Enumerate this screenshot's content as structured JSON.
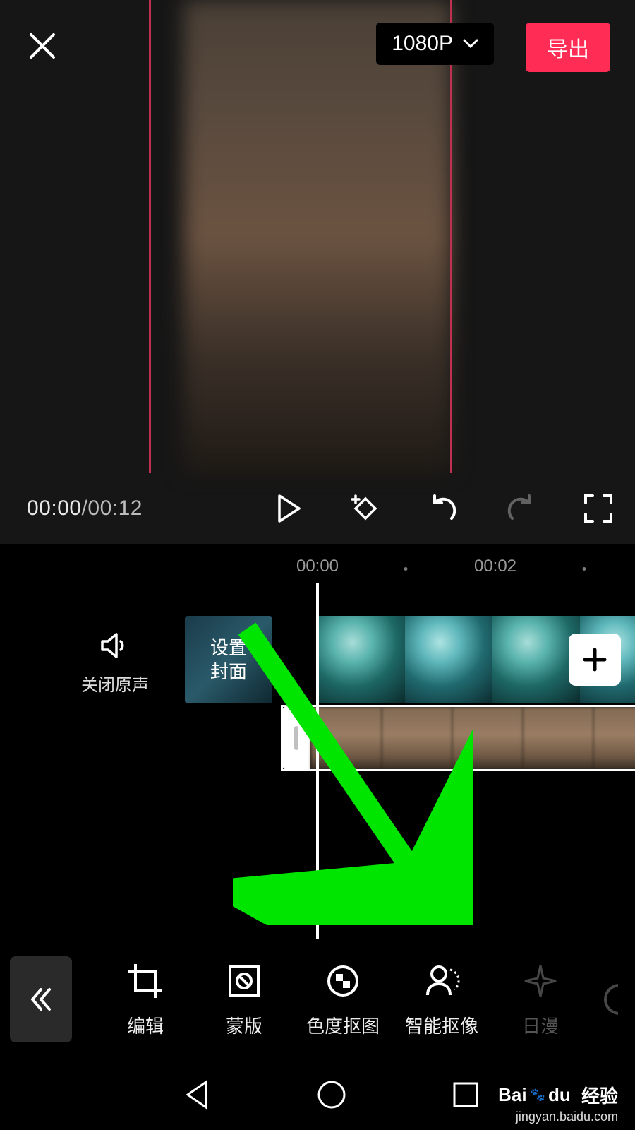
{
  "header": {
    "resolution_label": "1080P",
    "export_label": "导出"
  },
  "transport": {
    "current_time": "00:00",
    "duration": "00:12"
  },
  "ruler": {
    "t0": "00:00",
    "t1": "00:02"
  },
  "mute": {
    "label": "关闭原声"
  },
  "cover": {
    "line1": "设置",
    "line2": "封面"
  },
  "toolbar": {
    "items": [
      {
        "label": "编辑"
      },
      {
        "label": "蒙版"
      },
      {
        "label": "色度抠图"
      },
      {
        "label": "智能抠像"
      },
      {
        "label": "日漫"
      }
    ]
  },
  "watermark": {
    "brand": "Bai",
    "brand2": "du",
    "suffix": "经验",
    "url": "jingyan.baidu.com"
  }
}
